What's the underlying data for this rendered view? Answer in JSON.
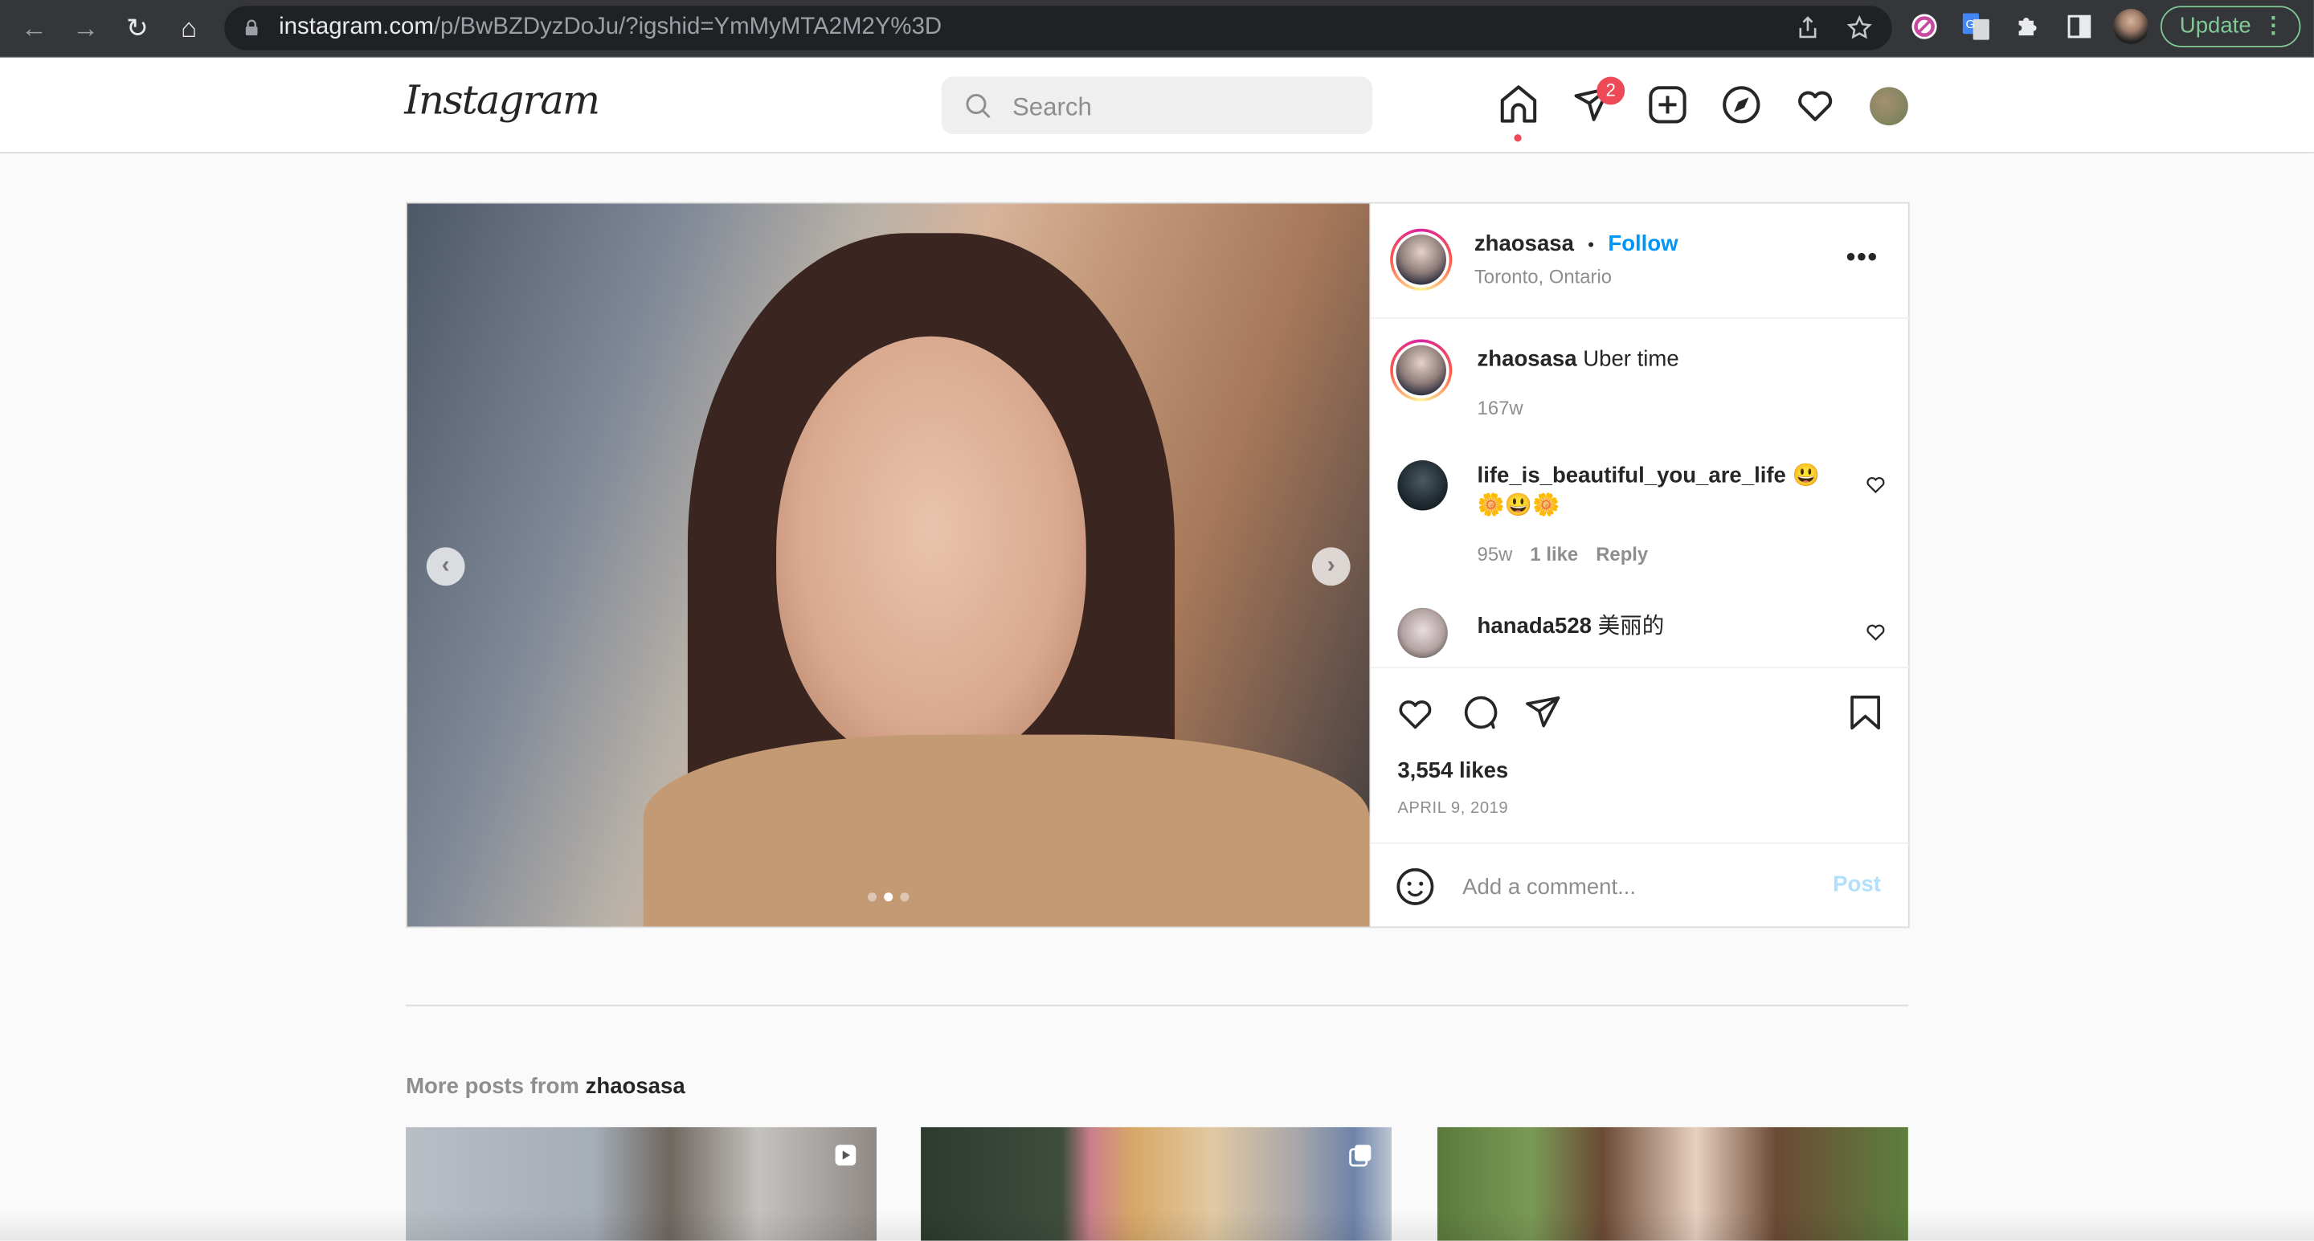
{
  "browser": {
    "url_host": "instagram.com",
    "url_path": "/p/BwBZDyzDoJu/?igshid=YmMyMTA2M2Y%3D",
    "update_label": "Update"
  },
  "header": {
    "logo": "Instagram",
    "search_placeholder": "Search",
    "messages_badge": "2"
  },
  "post": {
    "author": "zhaosasa",
    "separator": "•",
    "follow_label": "Follow",
    "location": "Toronto, Ontario",
    "more_label": "•••",
    "caption": {
      "username": "zhaosasa",
      "text": "Uber time",
      "time": "167w"
    },
    "comments": [
      {
        "username": "life_is_beautiful_you_are_life",
        "text": "😃",
        "text_line2": "🌼😃🌼",
        "time": "95w",
        "likes": "1 like",
        "reply": "Reply"
      },
      {
        "username": "hanada528",
        "text": "美丽的"
      }
    ],
    "likes": "3,554 likes",
    "date": "APRIL 9, 2019",
    "comment_placeholder": "Add a comment...",
    "post_label": "Post",
    "carousel": {
      "total_slides": 3,
      "active_slide": 2
    }
  },
  "more_posts": {
    "prefix": "More posts from",
    "username": "zhaosasa"
  }
}
